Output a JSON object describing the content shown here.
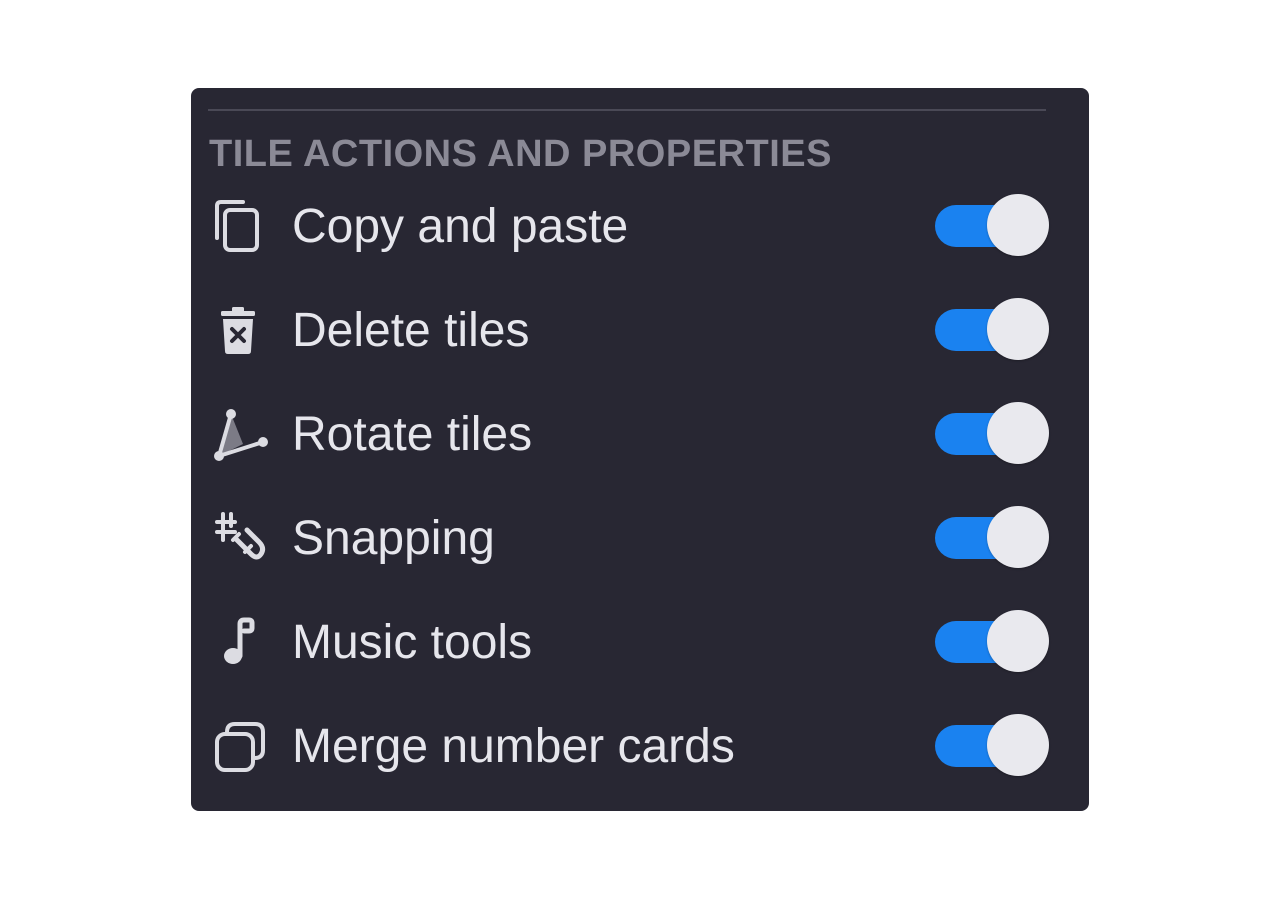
{
  "panel": {
    "section_title": "TILE ACTIONS AND PROPERTIES",
    "accent_color": "#1a82f0",
    "items": [
      {
        "icon": "copy-icon",
        "label": "Copy and paste",
        "enabled": true
      },
      {
        "icon": "trash-icon",
        "label": "Delete tiles",
        "enabled": true
      },
      {
        "icon": "angle-rotate-icon",
        "label": "Rotate tiles",
        "enabled": true
      },
      {
        "icon": "grid-magnet-icon",
        "label": "Snapping",
        "enabled": true
      },
      {
        "icon": "music-note-icon",
        "label": "Music tools",
        "enabled": true
      },
      {
        "icon": "stacked-cards-icon",
        "label": "Merge number cards",
        "enabled": true
      }
    ]
  }
}
